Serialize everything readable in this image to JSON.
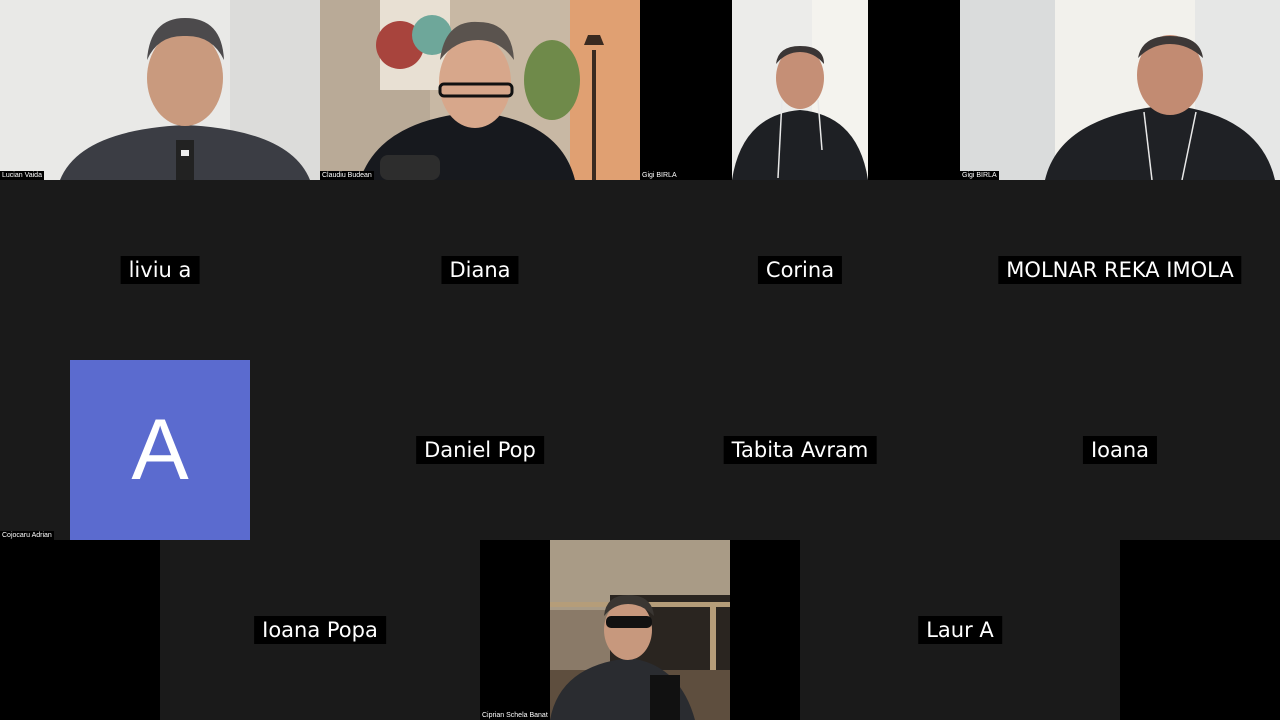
{
  "participants": {
    "lucian": "Lucian Vaida",
    "claudiu": "Claudiu Budean",
    "gigi1": "Gigi BIRLA",
    "gigi2": "Gigi BIRLA",
    "liviu": "liviu a",
    "diana": "Diana",
    "corina": "Corina",
    "molnar": "MOLNAR REKA IMOLA",
    "cojocaru": "Cojocaru Adrian",
    "cojocaru_initial": "A",
    "daniel": "Daniel Pop",
    "tabita": "Tabita Avram",
    "ioana": "Ioana",
    "ioana_popa": "Ioana Popa",
    "ciprian": "Ciprian Schela Banat",
    "laur": "Laur A"
  },
  "colors": {
    "background": "#1a1a1a",
    "avatar": "#5b6bcf"
  }
}
